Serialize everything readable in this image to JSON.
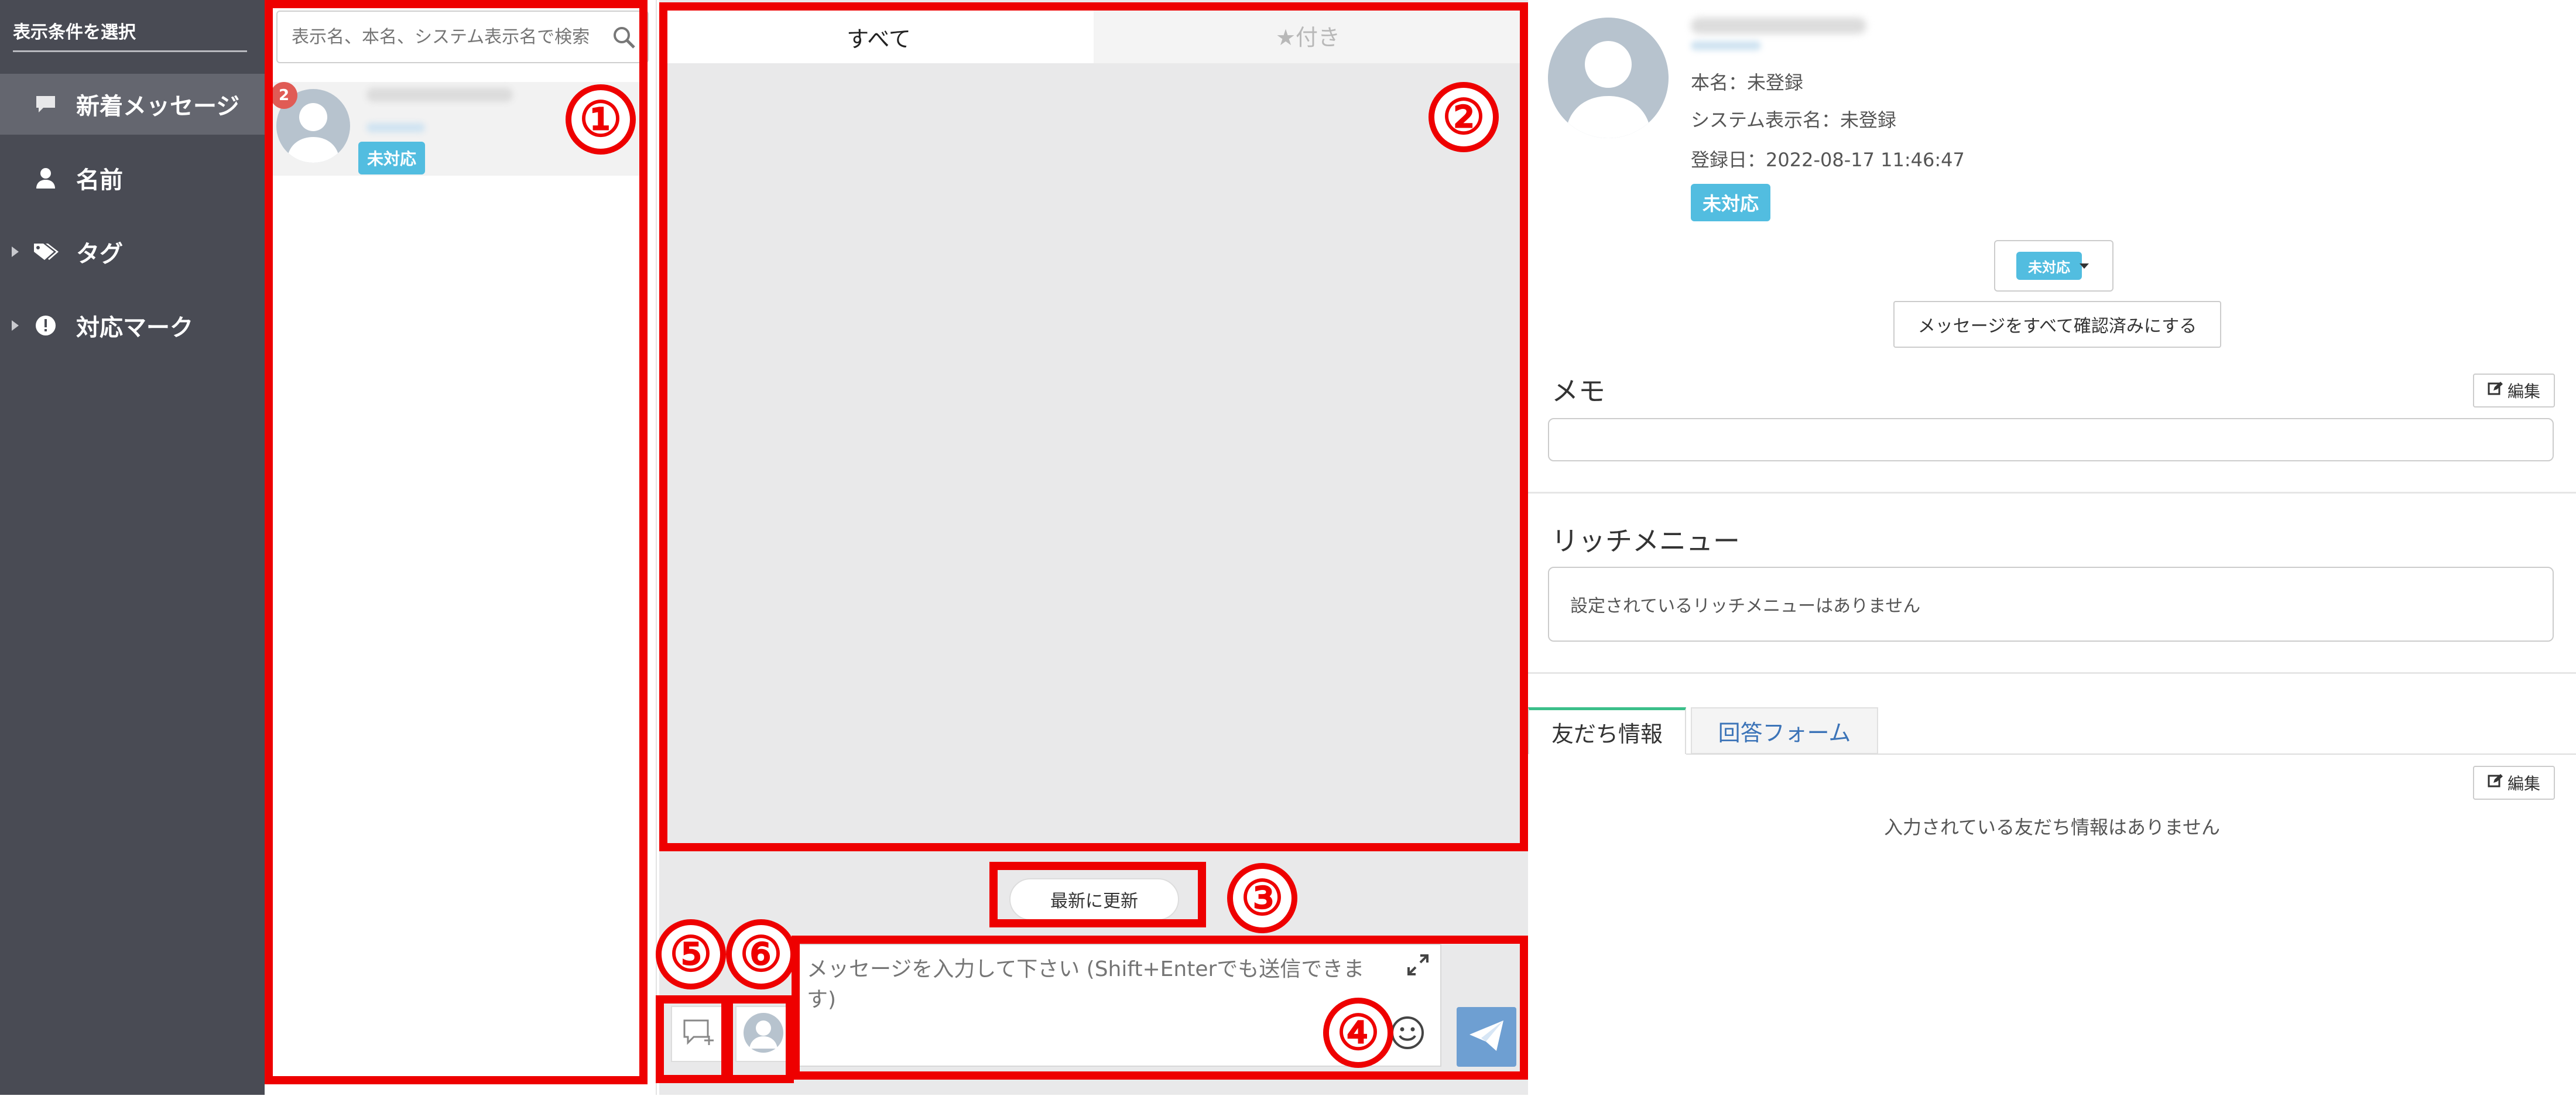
{
  "sidebar": {
    "header": "表示条件を選択",
    "items": [
      {
        "label": "新着メッセージ",
        "icon": "chat-bubble-icon"
      },
      {
        "label": "名前",
        "icon": "person-icon"
      },
      {
        "label": "タグ",
        "icon": "tag-icon"
      },
      {
        "label": "対応マーク",
        "icon": "exclamation-circle-icon"
      }
    ]
  },
  "list": {
    "search_placeholder": "表示名、本名、システム表示名で検索",
    "conversation": {
      "unread_count": "2",
      "status": "未対応"
    }
  },
  "chat": {
    "tabs": [
      "すべて",
      "★付き"
    ],
    "refresh_label": "最新に更新",
    "input_placeholder": "メッセージを入力して下さい (Shift+Enterでも送信できます)"
  },
  "profile": {
    "real_name": "本名：未登録",
    "system_name": "システム表示名：未登録",
    "registered": "登録日：2022-08-17 11:46:47",
    "status": "未対応",
    "status_select_value": "未対応",
    "confirm_all_label": "メッセージをすべて確認済みにする",
    "memo_title": "メモ",
    "edit_label": "編集",
    "rich_menu_title": "リッチメニュー",
    "rich_menu_empty": "設定されているリッチメニューはありません",
    "tabs": [
      "友だち情報",
      "回答フォーム"
    ],
    "friend_info_empty": "入力されている友だち情報はありません"
  },
  "annotations": [
    "①",
    "②",
    "③",
    "④",
    "⑤",
    "⑥"
  ],
  "colors": {
    "sidebar_bg": "#494b54",
    "status_tag": "#52bde0",
    "send_button": "#6e9fd2",
    "annotation_red": "#ee0000",
    "tab_accent_blue": "#3c74b8",
    "tab_accent_green": "#3bbf8a"
  }
}
